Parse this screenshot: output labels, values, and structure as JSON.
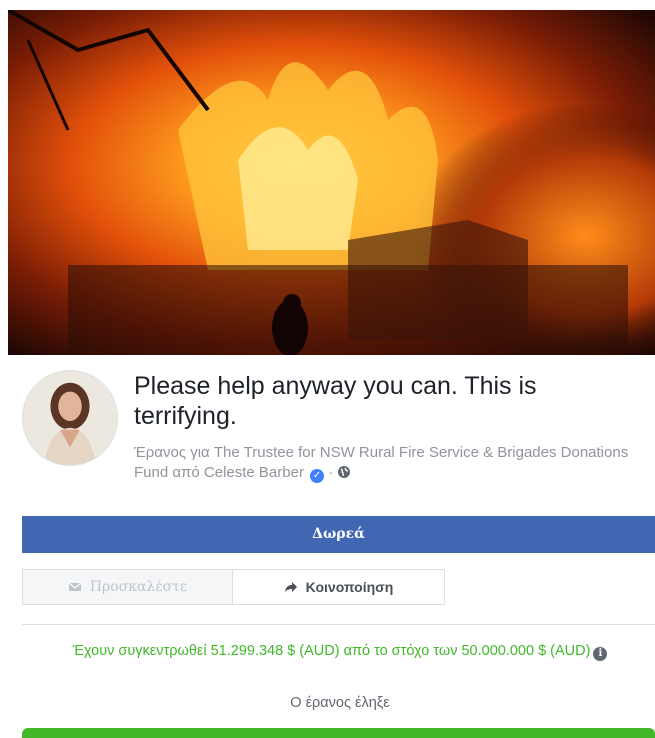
{
  "fundraiser": {
    "title": "Please help anyway you can. This is terrifying.",
    "subtitle_prefix": "Έρανος για The Trustee for NSW Rural Fire Service & Brigades Donations Fund από Celeste Barber",
    "subtitle_sep": "·"
  },
  "buttons": {
    "donate": "Δωρεά",
    "invite": "Προσκαλέστε",
    "share": "Κοινοποίηση"
  },
  "status": {
    "raised_text": "Έχουν συγκεντρωθεί 51.299.348 $ (AUD) από το στόχο των 50.000.000 $ (AUD)",
    "ended_text": "Ο έρανος έληξε",
    "progress_fraction": 1.0
  },
  "icons": {
    "verified": "verified-badge-icon",
    "privacy": "globe-icon",
    "invite": "envelope-icon",
    "share": "share-arrow-icon",
    "info": "info-icon"
  },
  "colors": {
    "donate_button": "#4267b2",
    "raised_text": "#42b72a",
    "progress_fill": "#42b72a"
  }
}
